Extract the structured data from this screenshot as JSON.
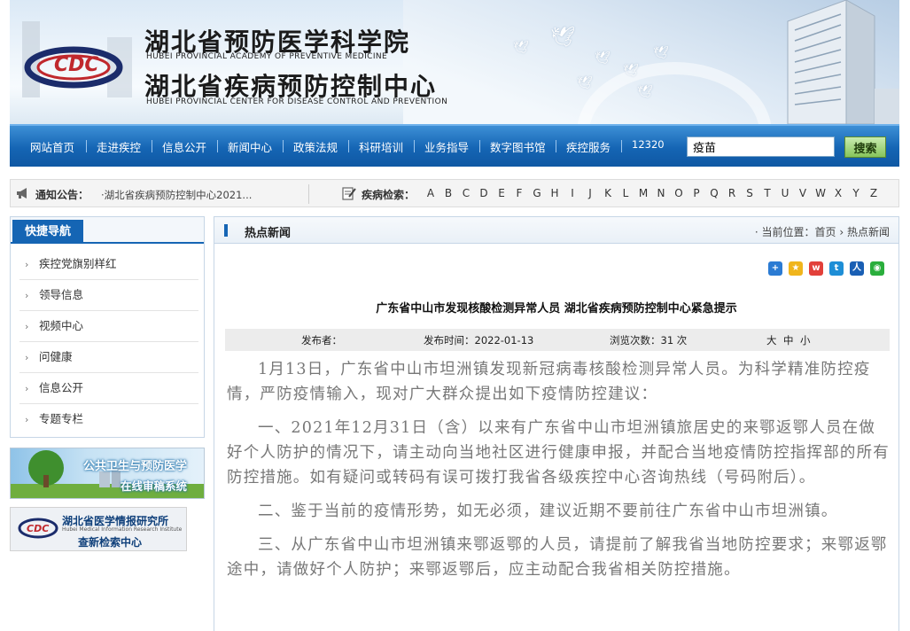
{
  "header": {
    "title_cn_1": "湖北省预防医学科学院",
    "title_en_1": "HUBEI PROVINCIAL ACADEMY OF PREVENTIVE MEDICINE",
    "title_cn_2": "湖北省疾病预防控制中心",
    "title_en_2": "HUBEI PROVINCIAL CENTER FOR DISEASE CONTROL AND PREVENTION",
    "logo_text": "CDC"
  },
  "nav": {
    "items": [
      "网站首页",
      "走进疾控",
      "信息公开",
      "新闻中心",
      "政策法规",
      "科研培训",
      "业务指导",
      "数字图书馆",
      "疾控服务",
      "12320"
    ],
    "search_value": "疫苗",
    "search_button": "搜索"
  },
  "notice": {
    "label": "通知公告：",
    "text": "·湖北省疾病预防控制中心2021...",
    "disease_label": "疾病检索：",
    "letters": [
      "A",
      "B",
      "C",
      "D",
      "E",
      "F",
      "G",
      "H",
      "I",
      "J",
      "K",
      "L",
      "M",
      "N",
      "O",
      "P",
      "Q",
      "R",
      "S",
      "T",
      "U",
      "V",
      "W",
      "X",
      "Y",
      "Z"
    ]
  },
  "sidebar": {
    "title": "快捷导航",
    "items": [
      "疾控党旗别样红",
      "领导信息",
      "视频中心",
      "问健康",
      "信息公开",
      "专题专栏"
    ],
    "ad1_line1": "公共卫生与预防医学",
    "ad1_line2": "在线审稿系统",
    "ad2_line1": "湖北省医学情报研究所",
    "ad2_line2": "Hubei Medical Information Research Institute",
    "ad2_line3": "查新检索中心"
  },
  "main": {
    "section_title": "热点新闻",
    "breadcrumb_prefix": "· 当前位置：",
    "breadcrumb_home": "首页",
    "breadcrumb_sep": " › ",
    "breadcrumb_current": "热点新闻",
    "share_icons": [
      "plus-share",
      "qzone",
      "weibo",
      "tencent-weibo",
      "renren",
      "wechat"
    ],
    "article_title": "广东省中山市发现核酸检测异常人员 湖北省疾病预防控制中心紧急提示",
    "meta": {
      "publisher": "发布者：",
      "date": "发布时间：2022-01-13",
      "views": "浏览次数：31 次",
      "font_large": "大",
      "font_medium": "中",
      "font_small": "小"
    },
    "paragraphs": [
      "1月13日，广东省中山市坦洲镇发现新冠病毒核酸检测异常人员。为科学精准防控疫情，严防疫情输入，现对广大群众提出如下疫情防控建议：",
      "一、2021年12月31日（含）以来有广东省中山市坦洲镇旅居史的来鄂返鄂人员在做好个人防护的情况下，请主动向当地社区进行健康申报，并配合当地疫情防控指挥部的所有防控措施。如有疑问或转码有误可拨打我省各级疾控中心咨询热线（号码附后）。",
      "二、鉴于当前的疫情形势，如无必须，建议近期不要前往广东省中山市坦洲镇。",
      "三、从广东省中山市坦洲镇来鄂返鄂的人员，请提前了解我省当地防控要求；来鄂返鄂途中，请做好个人防护；来鄂返鄂后，应主动配合我省相关防控措施。"
    ]
  },
  "colors": {
    "nav_blue": "#1565b4",
    "search_green": "#86c45b"
  }
}
